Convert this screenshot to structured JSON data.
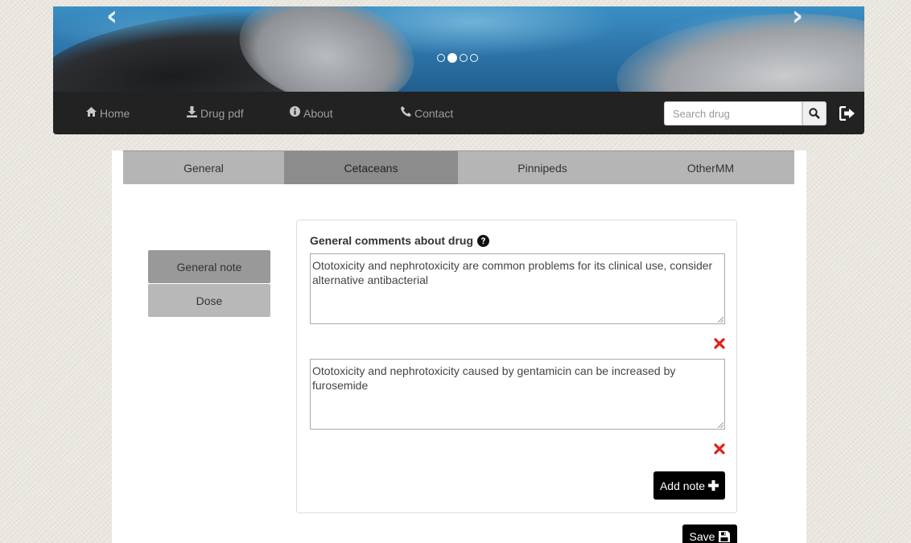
{
  "banner": {
    "slide_count": 4,
    "active_slide": 2
  },
  "nav": {
    "home": "Home",
    "drug_pdf": "Drug pdf",
    "about": "About",
    "contact": "Contact",
    "search_placeholder": "Search drug"
  },
  "tabs": [
    {
      "label": "General",
      "active": false
    },
    {
      "label": "Cetaceans",
      "active": true
    },
    {
      "label": "Pinnipeds",
      "active": false
    },
    {
      "label": "OtherMM",
      "active": false
    }
  ],
  "side_menu": {
    "general_note": "General note",
    "dose": "Dose"
  },
  "card": {
    "heading": "General comments about drug",
    "notes": [
      "Ototoxicity and nephrotoxicity are common problems for its clinical use, consider alternative antibacterial",
      "Ototoxicity and nephrotoxicity caused by gentamicin can be increased by furosemide"
    ],
    "add_note": "Add note",
    "save": "Save"
  },
  "colors": {
    "navbar": "#222222",
    "active_tab": "#8c8c8c",
    "inactive_tab": "#b5b5b5",
    "remove": "#e0201b",
    "button": "#000000"
  }
}
